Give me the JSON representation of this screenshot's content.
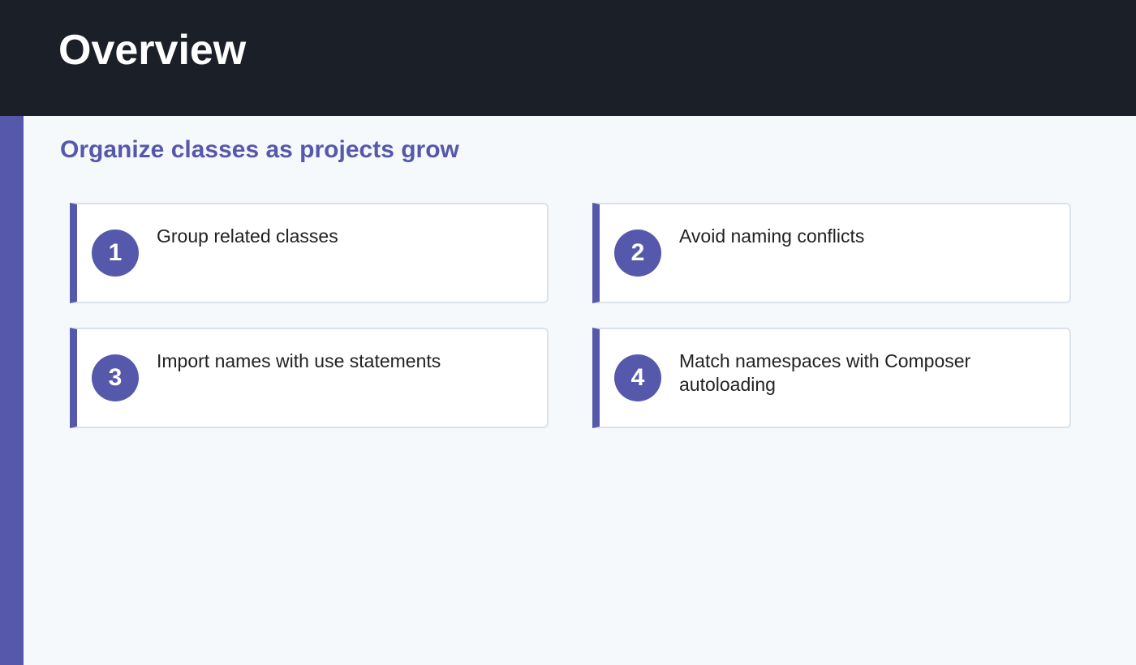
{
  "header": {
    "title": "Overview"
  },
  "section": {
    "subtitle": "Organize classes as projects grow"
  },
  "cards": [
    {
      "number": "1",
      "text": "Group related classes"
    },
    {
      "number": "2",
      "text": "Avoid naming conflicts"
    },
    {
      "number": "3",
      "text": "Import names with use statements"
    },
    {
      "number": "4",
      "text": "Match namespaces with Composer autoloading"
    }
  ],
  "colors": {
    "header_bg": "#1a1f28",
    "accent": "#5659ab",
    "page_bg": "#f5f9fc",
    "card_bg": "#ffffff",
    "card_border": "#dce2ea"
  }
}
